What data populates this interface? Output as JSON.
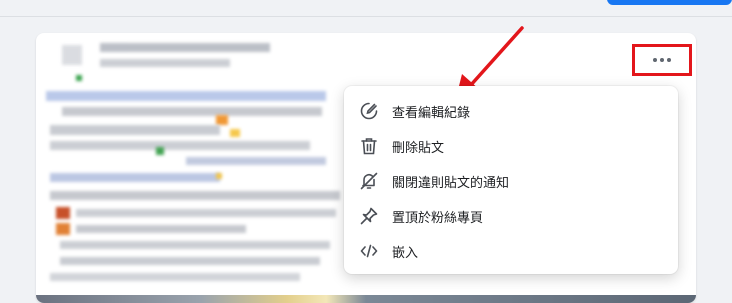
{
  "menu": {
    "items": [
      {
        "label": "查看編輯紀錄",
        "icon": "edit-history-icon"
      },
      {
        "label": "刪除貼文",
        "icon": "trash-icon"
      },
      {
        "label": "關閉違則貼文的通知",
        "icon": "bell-off-icon"
      },
      {
        "label": "置頂於粉絲專頁",
        "icon": "pin-icon"
      },
      {
        "label": "嵌入",
        "icon": "code-icon"
      }
    ]
  },
  "more_button": {
    "icon": "more-horizontal-icon"
  },
  "annotation": {
    "color": "#e3161b"
  },
  "colors": {
    "brand_blue": "#1877f2",
    "background": "#f0f2f5",
    "highlight": "#e3161b"
  }
}
